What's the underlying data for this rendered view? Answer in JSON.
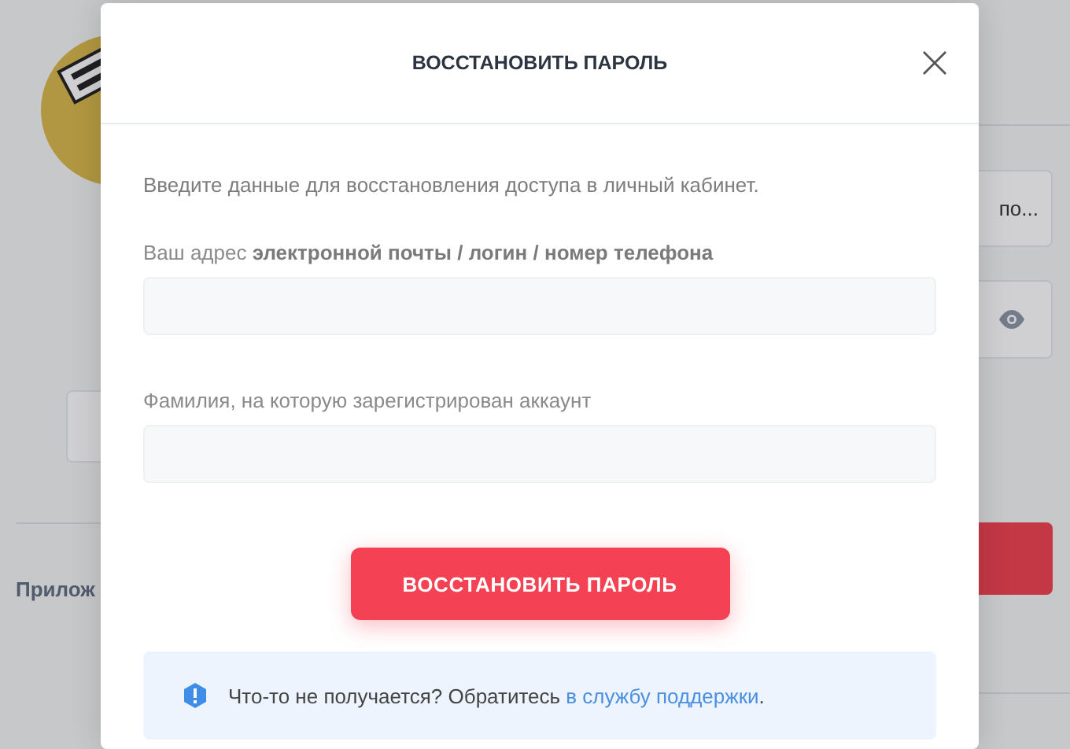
{
  "background": {
    "side_label": "Прилож",
    "field_value": "по..."
  },
  "modal": {
    "title": "ВОССТАНОВИТЬ ПАРОЛЬ",
    "intro": "Введите данные для восстановления доступа в личный кабинет.",
    "fields": [
      {
        "label": "Ваш адрес **электронной почты / логин / номер телефона**"
      },
      {
        "label": "Фамилия, на которую зарегистрирован аккаунт"
      }
    ],
    "submit": "ВОССТАНОВИТЬ ПАРОЛЬ",
    "notice": {
      "before": "Что-то не получается? Обратитесь",
      "link": "в службу поддержки",
      "after": "."
    }
  }
}
